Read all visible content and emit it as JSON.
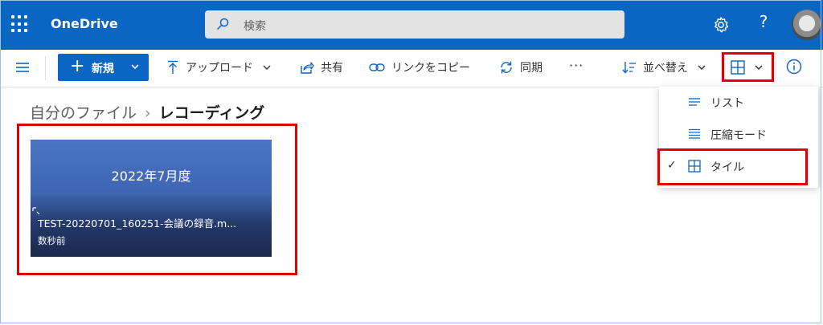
{
  "app": {
    "brand": "OneDrive"
  },
  "search": {
    "placeholder": "検索"
  },
  "header": {
    "help_label": "?"
  },
  "commands": {
    "new_label": "新規",
    "upload_label": "アップロード",
    "share_label": "共有",
    "copy_link_label": "リンクをコピー",
    "sync_label": "同期",
    "more_label": "···",
    "sort_label": "並べ替え"
  },
  "breadcrumb": {
    "root": "自分のファイル",
    "separator": "›",
    "current": "レコーディング"
  },
  "tile": {
    "cover_text": "2022年7月度",
    "file_name": "TEST-20220701_160251-会議の録音.m...",
    "modified": "数秒前"
  },
  "view_menu": {
    "items": [
      {
        "label": "リスト",
        "icon": "list-icon",
        "selected": false
      },
      {
        "label": "圧縮モード",
        "icon": "compact-list-icon",
        "selected": false
      },
      {
        "label": "タイル",
        "icon": "tiles-icon",
        "selected": true
      }
    ],
    "check_glyph": "✓"
  },
  "colors": {
    "suitebar": "#0a66c2",
    "accent": "#0a66c2",
    "highlight": "#e00000"
  }
}
